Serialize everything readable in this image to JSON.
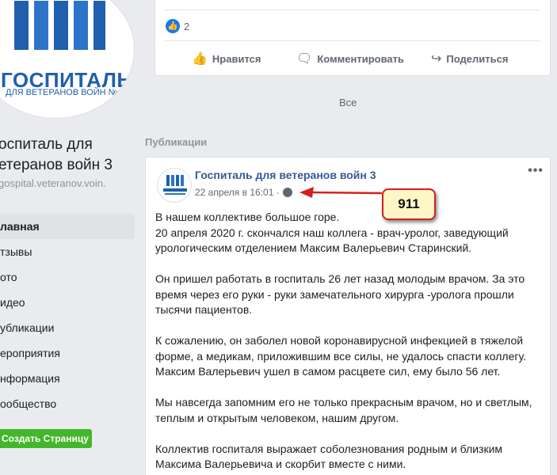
{
  "sidebar": {
    "logo_title": "ГОСПИТАЛЬ",
    "logo_subtitle": "ДЛЯ ВЕТЕРАНОВ ВОЙН №",
    "page_name_line1": "оспиталь для",
    "page_name_line2": "етеранов войн 3",
    "handle": "gospital.veteranov.voin.",
    "nav": [
      {
        "label": "лавная",
        "active": true
      },
      {
        "label": "тзывы"
      },
      {
        "label": "ото"
      },
      {
        "label": "идео"
      },
      {
        "label": "убликации"
      },
      {
        "label": "ероприятия"
      },
      {
        "label": "нформация"
      },
      {
        "label": "ообщество"
      }
    ],
    "create_button": "Создать Страницу"
  },
  "top_card": {
    "like_count": "2",
    "actions": {
      "like": "Нравится",
      "comment": "Комментировать",
      "share": "Поделиться"
    }
  },
  "all_link": "Все",
  "section_title": "Публикации",
  "post": {
    "author": "Госпиталь для ветеранов войн 3",
    "time": "22 апреля в 16:01 ·",
    "paragraphs": [
      "В нашем коллективе большое горе.\n20 апреля 2020 г. скончался наш коллега - врач-уролог, заведующий\nурологическим отделением Максим Валерьевич Старинский.",
      "Он пришел работать в госпиталь 26 лет назад молодым врачом. За это\nвремя через его руки - руки замечательного хирурга -уролога прошли\nтысячи пациентов.",
      "К сожалению, он заболел новой коронавирусной инфекцией в тяжелой\nформе, а медикам, приложившим все силы, не удалось спасти коллегу.\nМаксим Валерьевич ушел в самом расцвете сил, ему было 56 лет.",
      "Мы навсегда запомним его не только прекрасным врачом, но и светлым,\nтеплым и открытым человеком, нашим другом.",
      "Коллектив госпиталя выражает соболезнования родным и близким\nМаксима Валерьевича и скорбит вместе с ними."
    ]
  },
  "annotation": {
    "label": "911",
    "border_color": "#d42020",
    "fill_color": "#fff6c8"
  },
  "colors": {
    "brand_blue": "#1f5fae",
    "link": "#385898",
    "green": "#42b72a"
  }
}
